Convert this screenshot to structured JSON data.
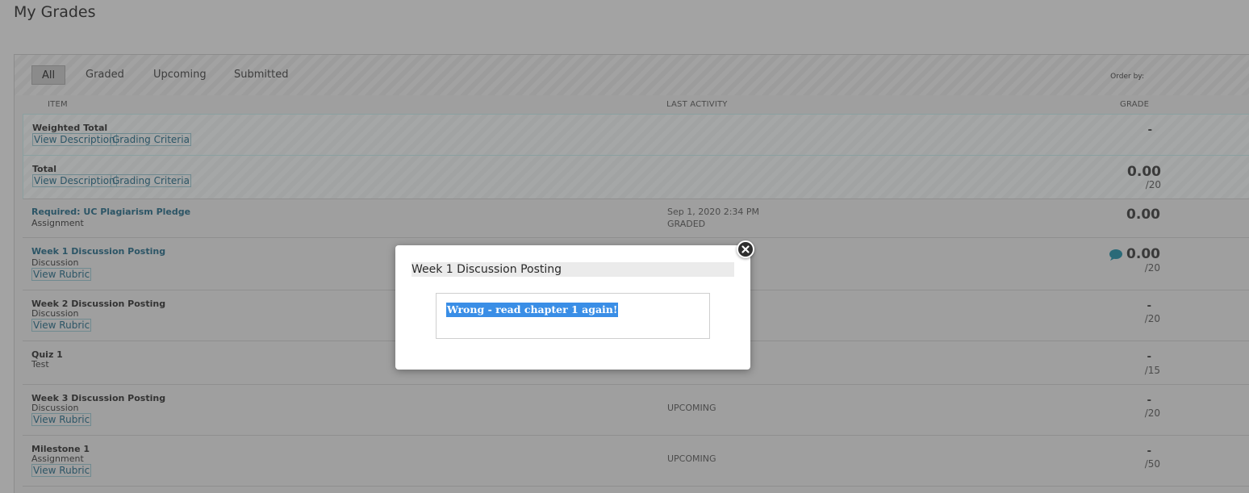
{
  "page_title": "My Grades",
  "filters": {
    "tabs": [
      {
        "label": "All",
        "active": true
      },
      {
        "label": "Graded",
        "active": false
      },
      {
        "label": "Upcoming",
        "active": false
      },
      {
        "label": "Submitted",
        "active": false
      }
    ],
    "order_by_label": "Order by:"
  },
  "columns": {
    "item": "ITEM",
    "last_activity": "LAST ACTIVITY",
    "grade": "GRADE"
  },
  "rows": [
    {
      "title": "Weighted Total",
      "links": [
        "View Description",
        "Grading Criteria"
      ],
      "grade": "-"
    },
    {
      "title": "Total",
      "links": [
        "View Description",
        "Grading Criteria"
      ],
      "grade": "0.00",
      "out_of": "/20"
    },
    {
      "title": "Required: UC Plagiarism Pledge",
      "type": "Assignment",
      "activity_date": "Sep 1, 2020 2:34 PM",
      "activity_status": "GRADED",
      "grade": "0.00"
    },
    {
      "title": "Week 1 Discussion Posting",
      "type": "Discussion",
      "links": [
        "View Rubric"
      ],
      "grade": "0.00",
      "out_of": "/20"
    },
    {
      "title": "Week 2 Discussion Posting",
      "type": "Discussion",
      "links": [
        "View Rubric"
      ],
      "grade": "-",
      "out_of": "/20"
    },
    {
      "title": "Quiz 1",
      "type": "Test",
      "grade": "-",
      "out_of": "/15"
    },
    {
      "title": "Week 3 Discussion Posting",
      "type": "Discussion",
      "links": [
        "View Rubric"
      ],
      "activity_status": "UPCOMING",
      "grade": "-",
      "out_of": "/20"
    },
    {
      "title": "Milestone 1",
      "type": "Assignment",
      "links": [
        "View Rubric"
      ],
      "activity_status": "UPCOMING",
      "grade": "-",
      "out_of": "/50"
    }
  ],
  "modal": {
    "title": "Week 1 Discussion Posting",
    "feedback": "Wrong - read chapter 1 again!"
  },
  "colors": {
    "overlay_bg": "#a3a3a3",
    "link": "#2c5566",
    "selection": "#3a8ee6",
    "comment_icon": "#2a6a78"
  },
  "icons": {
    "comment": "comment-bubble-icon",
    "close": "close-icon"
  }
}
